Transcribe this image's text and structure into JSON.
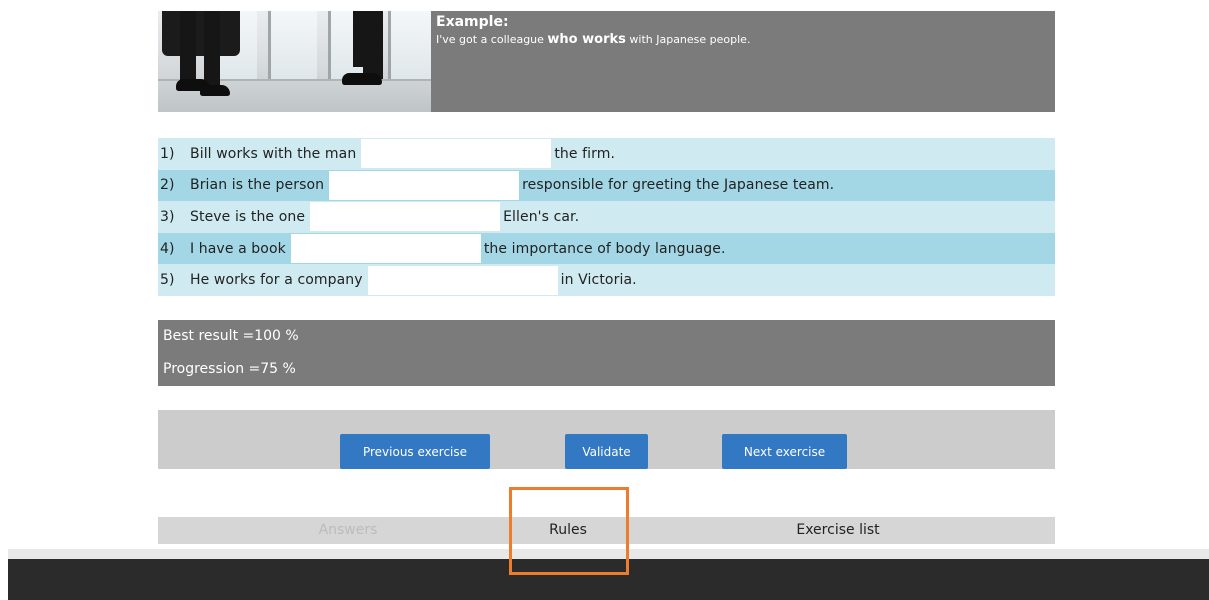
{
  "example": {
    "title": "Example:",
    "text_before": "I've got a colleague ",
    "text_bold": "who works",
    "text_after": " with Japanese people."
  },
  "exercise": {
    "rows": [
      {
        "num": "1)",
        "before": "Bill works with the man",
        "value": "",
        "after": "the firm."
      },
      {
        "num": "2)",
        "before": "Brian is the person",
        "value": "",
        "after": "responsible for greeting the Japanese team."
      },
      {
        "num": "3)",
        "before": "Steve is the one",
        "value": "",
        "after": "Ellen's car."
      },
      {
        "num": "4)",
        "before": "I have a book",
        "value": "",
        "after": "the importance of body language."
      },
      {
        "num": "5)",
        "before": "He works for a company",
        "value": "",
        "after": "in Victoria."
      }
    ]
  },
  "score": {
    "best_result": "Best result =100 %",
    "progression": "Progression =75 %"
  },
  "buttons": {
    "previous": "Previous exercise",
    "validate": "Validate",
    "next": "Next exercise"
  },
  "tabs": {
    "answers": "Answers",
    "rules": "Rules",
    "exercise_list": "Exercise list"
  },
  "colors": {
    "accent_button": "#3278c2",
    "highlight": "#ee7c2d",
    "row_light": "#cfeaf1",
    "row_dark": "#a3d7e5"
  },
  "icons": {
    "photo": "business-people-photo"
  }
}
